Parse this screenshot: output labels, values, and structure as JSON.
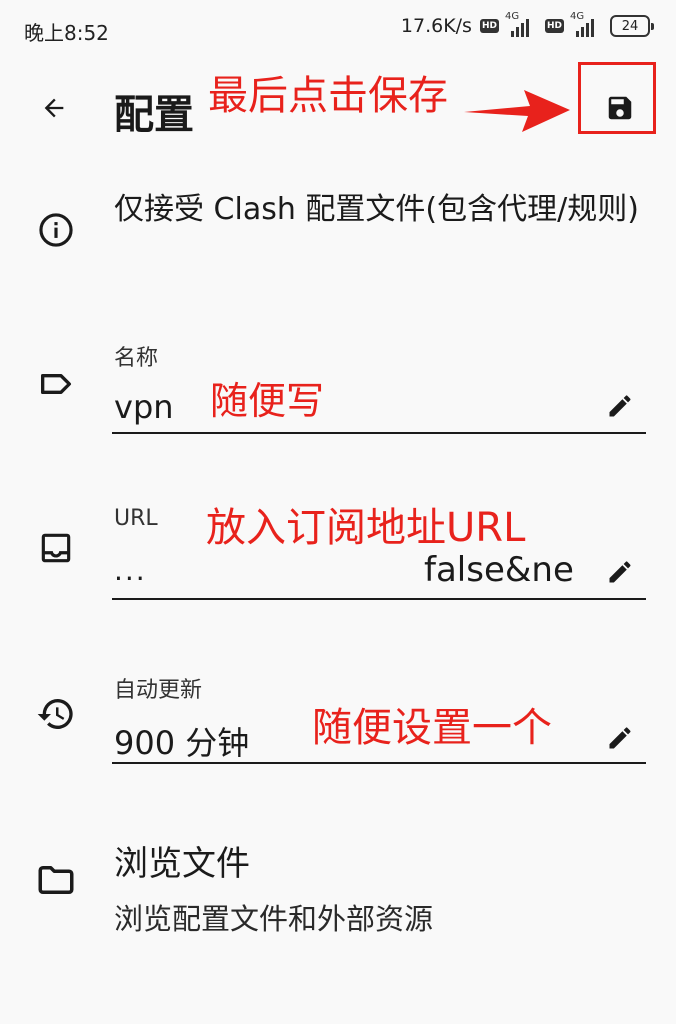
{
  "status_bar": {
    "time": "晚上8:52",
    "net_speed": "17.6K/s",
    "hd1": "HD",
    "net1": "4G",
    "hd2": "HD",
    "net2": "4G",
    "battery": "24"
  },
  "app_bar": {
    "back_icon": "arrow-back-icon",
    "title": "配置",
    "save_icon": "floppy-disk-icon"
  },
  "info": {
    "icon": "info-circle-icon",
    "text": "仅接受 Clash 配置文件(包含代理/规则)"
  },
  "fields": {
    "name": {
      "icon": "label-tag-icon",
      "label": "名称",
      "value": "vpn",
      "edit_icon": "pencil-icon"
    },
    "url": {
      "icon": "inbox-tray-icon",
      "label": "URL",
      "ellipsis": "...",
      "value": "false&ne",
      "edit_icon": "pencil-icon"
    },
    "auto_update": {
      "icon": "history-clock-icon",
      "label": "自动更新",
      "value": "900 分钟",
      "edit_icon": "pencil-icon"
    }
  },
  "browse": {
    "icon": "folder-icon",
    "title": "浏览文件",
    "subtitle": "浏览配置文件和外部资源"
  },
  "annotations": {
    "save_hint": "最后点击保存",
    "name_hint": "随便写",
    "url_hint": "放入订阅地址URL",
    "update_hint": "随便设置一个",
    "color": "#e8221c"
  }
}
